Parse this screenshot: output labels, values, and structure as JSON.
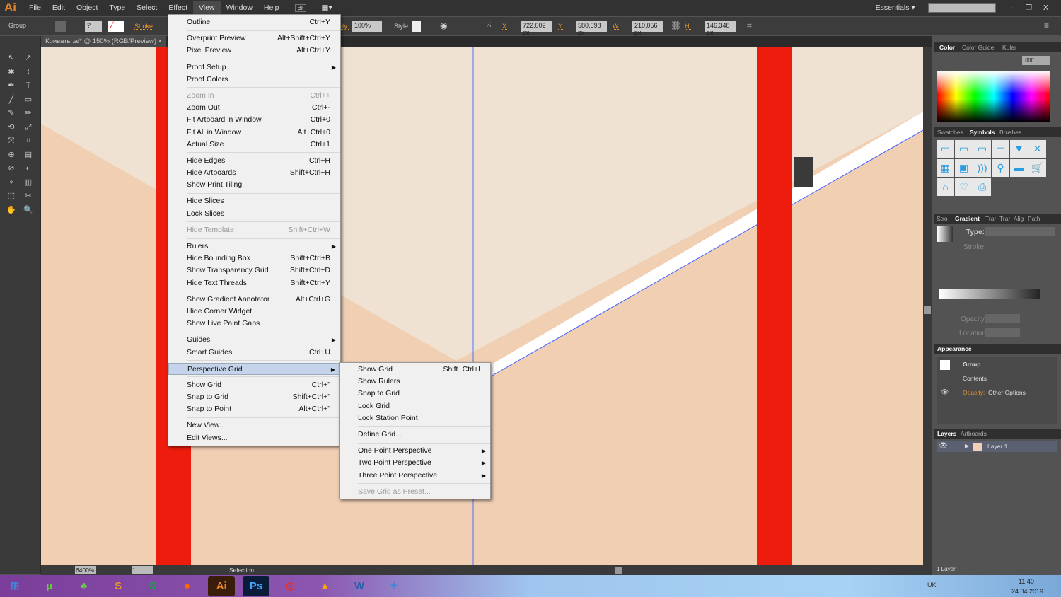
{
  "app": {
    "logo": "Ai",
    "menus": [
      "File",
      "Edit",
      "Object",
      "Type",
      "Select",
      "Effect",
      "View",
      "Window",
      "Help"
    ],
    "bridge": "Br",
    "workspace": "Essentials",
    "search_placeholder": ""
  },
  "control": {
    "selection": "Group",
    "stroke_label": "Stroke:",
    "opacity_label": "ity:",
    "opacity": "100%",
    "style_label": "Style:",
    "x_label": "X:",
    "x": "722,002 px",
    "y_label": "Y:",
    "y": "580,598 px",
    "w_label": "W:",
    "w": "210,056 px",
    "h_label": "H:",
    "h": "146,348 px"
  },
  "document": {
    "tab": "Кривать .ai* @ 150% (RGB/Preview)",
    "close": "×"
  },
  "view_menu": [
    {
      "label": "Outline",
      "shortcut": "Ctrl+Y"
    },
    {
      "sep": true
    },
    {
      "label": "Overprint Preview",
      "shortcut": "Alt+Shift+Ctrl+Y"
    },
    {
      "label": "Pixel Preview",
      "shortcut": "Alt+Ctrl+Y"
    },
    {
      "sep": true
    },
    {
      "label": "Proof Setup",
      "submenu": true
    },
    {
      "label": "Proof Colors"
    },
    {
      "sep": true
    },
    {
      "label": "Zoom In",
      "shortcut": "Ctrl++",
      "disabled": true
    },
    {
      "label": "Zoom Out",
      "shortcut": "Ctrl+-"
    },
    {
      "label": "Fit Artboard in Window",
      "shortcut": "Ctrl+0"
    },
    {
      "label": "Fit All in Window",
      "shortcut": "Alt+Ctrl+0"
    },
    {
      "label": "Actual Size",
      "shortcut": "Ctrl+1"
    },
    {
      "sep": true
    },
    {
      "label": "Hide Edges",
      "shortcut": "Ctrl+H"
    },
    {
      "label": "Hide Artboards",
      "shortcut": "Shift+Ctrl+H"
    },
    {
      "label": "Show Print Tiling"
    },
    {
      "sep": true
    },
    {
      "label": "Hide Slices"
    },
    {
      "label": "Lock Slices"
    },
    {
      "sep": true
    },
    {
      "label": "Hide Template",
      "shortcut": "Shift+Ctrl+W",
      "disabled": true
    },
    {
      "sep": true
    },
    {
      "label": "Rulers",
      "submenu": true
    },
    {
      "label": "Hide Bounding Box",
      "shortcut": "Shift+Ctrl+B"
    },
    {
      "label": "Show Transparency Grid",
      "shortcut": "Shift+Ctrl+D"
    },
    {
      "label": "Hide Text Threads",
      "shortcut": "Shift+Ctrl+Y"
    },
    {
      "sep": true
    },
    {
      "label": "Show Gradient Annotator",
      "shortcut": "Alt+Ctrl+G"
    },
    {
      "label": "Hide Corner Widget"
    },
    {
      "label": "Show Live Paint Gaps"
    },
    {
      "sep": true
    },
    {
      "label": "Guides",
      "submenu": true
    },
    {
      "label": "Smart Guides",
      "shortcut": "Ctrl+U"
    },
    {
      "sep": true
    },
    {
      "label": "Perspective Grid",
      "submenu": true,
      "highlighted": true
    },
    {
      "sep": true
    },
    {
      "label": "Show Grid",
      "shortcut": "Ctrl+\""
    },
    {
      "label": "Snap to Grid",
      "shortcut": "Shift+Ctrl+\""
    },
    {
      "label": "Snap to Point",
      "shortcut": "Alt+Ctrl+\""
    },
    {
      "sep": true
    },
    {
      "label": "New View..."
    },
    {
      "label": "Edit Views..."
    }
  ],
  "perspective_menu": [
    {
      "label": "Show Grid",
      "shortcut": "Shift+Ctrl+I"
    },
    {
      "label": "Show Rulers"
    },
    {
      "label": "Snap to Grid"
    },
    {
      "label": "Lock Grid"
    },
    {
      "label": "Lock Station Point"
    },
    {
      "sep": true
    },
    {
      "label": "Define Grid..."
    },
    {
      "sep": true
    },
    {
      "label": "One Point Perspective",
      "submenu": true
    },
    {
      "label": "Two Point Perspective",
      "submenu": true
    },
    {
      "label": "Three Point Perspective",
      "submenu": true
    },
    {
      "sep": true
    },
    {
      "label": "Save Grid as Preset...",
      "disabled": true
    }
  ],
  "panels": {
    "color": {
      "tabs": [
        "Color",
        "Color Guide",
        "Kuler"
      ],
      "hex": "ffffff"
    },
    "symbols": {
      "tabs": [
        "Swatches",
        "Symbols",
        "Brushes"
      ],
      "icons": [
        "button-1",
        "button-2",
        "button-3",
        "button-4",
        "dropdown",
        "close",
        "calendar",
        "film",
        "rss",
        "search",
        "credit-card",
        "cart",
        "home",
        "heart-plus",
        "printer"
      ]
    },
    "gradient": {
      "tabs": [
        "Stro",
        "Gradient",
        "Trar",
        "Trar",
        "Alig",
        "Path"
      ],
      "type_label": "Type:",
      "stroke_label": "Stroke:",
      "opacity_label": "Opacity:",
      "location_label": "Location:"
    },
    "appearance": {
      "title": "Appearance",
      "group": "Group",
      "contents": "Contents",
      "opacity_label": "Opacity:",
      "opacity_value": "Other Options"
    },
    "layers": {
      "tabs": [
        "Layers",
        "Artboards"
      ],
      "layer": "Layer 1",
      "count": "1 Layer"
    }
  },
  "status": {
    "zoom": "6400%",
    "page": "1",
    "tool": "Selection"
  },
  "taskbar": {
    "lang": "UK",
    "time": "11:40",
    "date": "24.04.2019",
    "apps": [
      "start",
      "utorrent",
      "clover",
      "sublime",
      "skype",
      "firefox",
      "illustrator",
      "photoshop",
      "chrome",
      "aimp",
      "word",
      "app"
    ]
  },
  "colors": {
    "red": "#ee1c0c",
    "peach": "#f0cfb3",
    "beige": "#efe2d3",
    "accent": "#e8842a"
  }
}
